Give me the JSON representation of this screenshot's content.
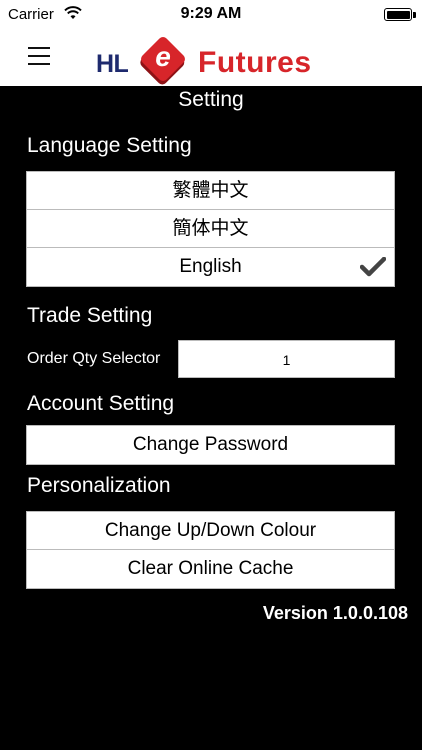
{
  "status_bar": {
    "carrier": "Carrier",
    "time": "9:29 AM"
  },
  "header": {
    "logo_hl": "HL",
    "logo_e": "e",
    "logo_futures": "Futures"
  },
  "page": {
    "title": "Setting"
  },
  "language_section": {
    "heading": "Language Setting",
    "options": [
      {
        "label": "繁體中文",
        "selected": false
      },
      {
        "label": "簡体中文",
        "selected": false
      },
      {
        "label": "English",
        "selected": true
      }
    ]
  },
  "trade_section": {
    "heading": "Trade Setting",
    "qty_label": "Order Qty Selector",
    "qty_value": "1"
  },
  "account_section": {
    "heading": "Account Setting",
    "change_password": "Change Password"
  },
  "personalization_section": {
    "heading": "Personalization",
    "change_colour": "Change Up/Down Colour",
    "clear_cache": "Clear Online Cache"
  },
  "footer": {
    "version": "Version 1.0.0.108"
  },
  "colors": {
    "brand_red": "#d7252a",
    "brand_navy": "#1e2a6e",
    "background": "#000000"
  },
  "icons": {
    "menu": "hamburger-icon",
    "check": "checkmark-icon",
    "wifi": "wifi-icon",
    "battery": "battery-icon"
  }
}
